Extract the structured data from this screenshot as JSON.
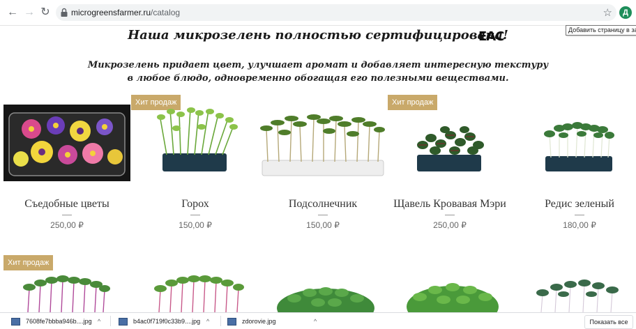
{
  "browser": {
    "url_domain": "microgreensfarmer.ru",
    "url_path": "/catalog",
    "avatar_letter": "Д",
    "tooltip": "Добавить страницу в закладки"
  },
  "page": {
    "heading": "Наша микрозелень полностью сертифицирована!",
    "cert_mark": "ЕАС",
    "subheading": "Микрозелень придает цвет, улучшает аромат и добавляет интересную текстуру в любое блюдо, одновременно обогащая его полезными веществами.",
    "badge_label": "Хит продаж"
  },
  "products": [
    {
      "name": "Съедобные цветы",
      "price": "250,00 ₽"
    },
    {
      "name": "Горох",
      "price": "150,00 ₽"
    },
    {
      "name": "Подсолнечник",
      "price": "150,00 ₽"
    },
    {
      "name": "Щавель Кровавая Мэри",
      "price": "250,00 ₽"
    },
    {
      "name": "Редис зеленый",
      "price": "180,00 ₽"
    }
  ],
  "downloads": {
    "items": [
      "7608fe7bbba946b....jpg",
      "b4ac0f719f0c33b9....jpg",
      "zdorovie.jpg"
    ],
    "show_all": "Показать все"
  },
  "colors": {
    "badge": "#c9a96a",
    "avatar": "#1e8e5a"
  }
}
